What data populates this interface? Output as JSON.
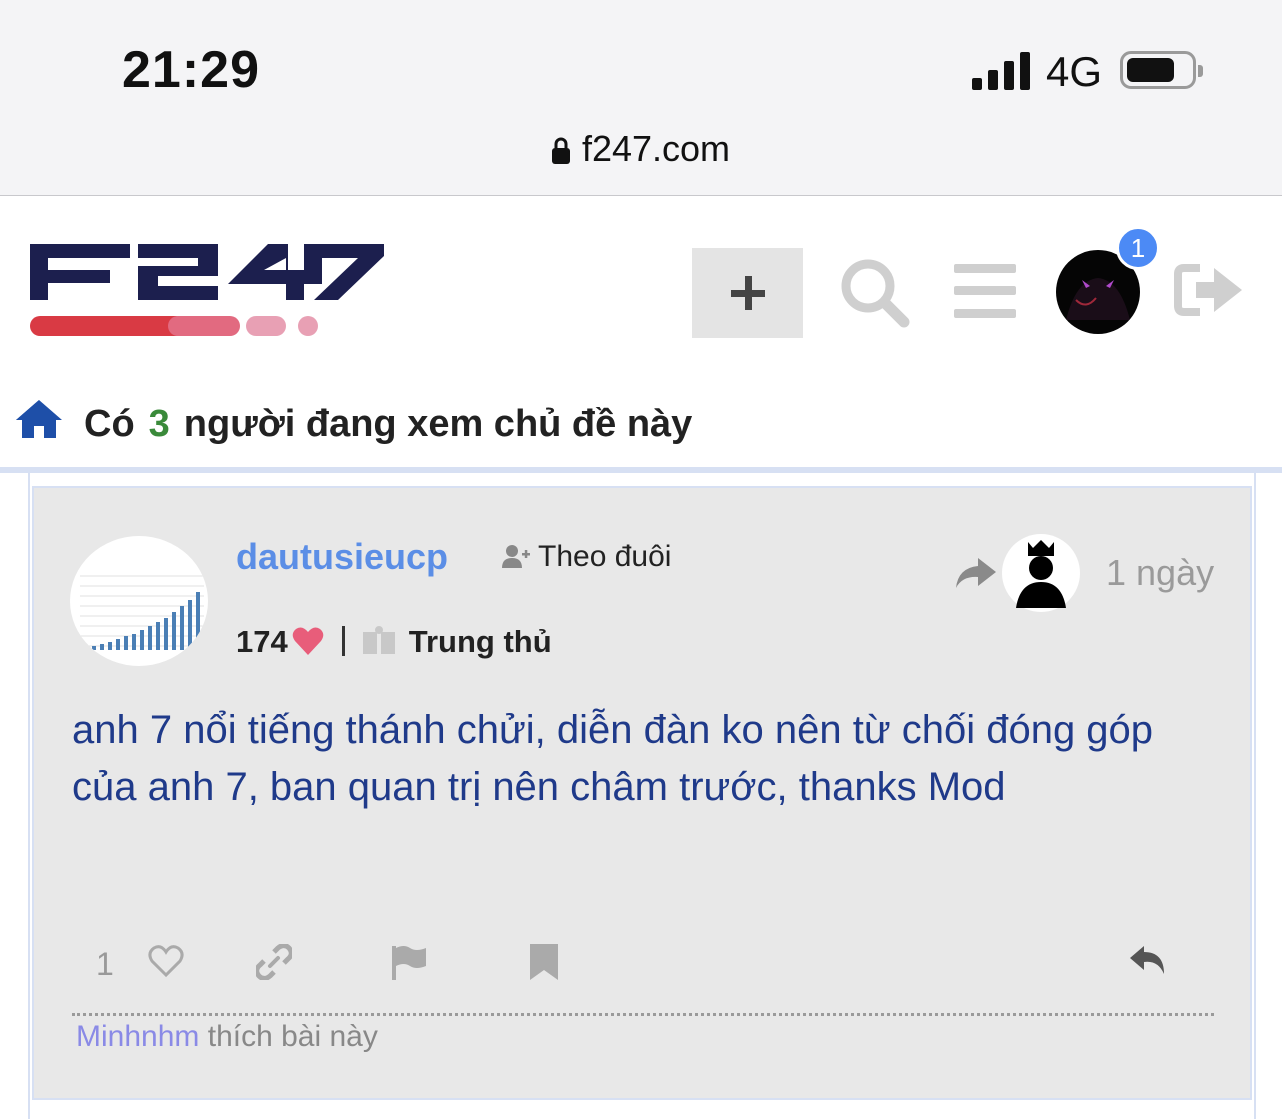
{
  "status_bar": {
    "time": "21:29",
    "network": "4G",
    "battery_fraction": 0.75
  },
  "browser": {
    "url": "f247.com"
  },
  "header": {
    "logo_text": "F247",
    "notification_count": "1",
    "icons": [
      "plus-icon",
      "search-icon",
      "menu-icon",
      "user-avatar",
      "logout-icon"
    ]
  },
  "topic": {
    "viewers_prefix": "Có",
    "viewers_count": "3",
    "viewers_suffix": "người đang xem chủ đề này"
  },
  "post": {
    "username": "dautusieucp",
    "follow_label": "Theo đuôi",
    "time_ago": "1 ngày",
    "reputation": "174",
    "rank": "Trung thủ",
    "body": "anh 7 nổi tiếng thánh chửi, diễn đàn ko nên từ chối đóng góp của anh 7, ban quan trị nên châm trước, thanks Mod",
    "like_count": "1",
    "liked_by_user": "Minhnhm",
    "liked_by_suffix": "thích bài này"
  },
  "colors": {
    "username": "#5b8ee6",
    "body_text": "#1f3a8a",
    "viewer_count": "#3a8a3a",
    "badge": "#4c8af5",
    "heart": "#e85d7a"
  }
}
